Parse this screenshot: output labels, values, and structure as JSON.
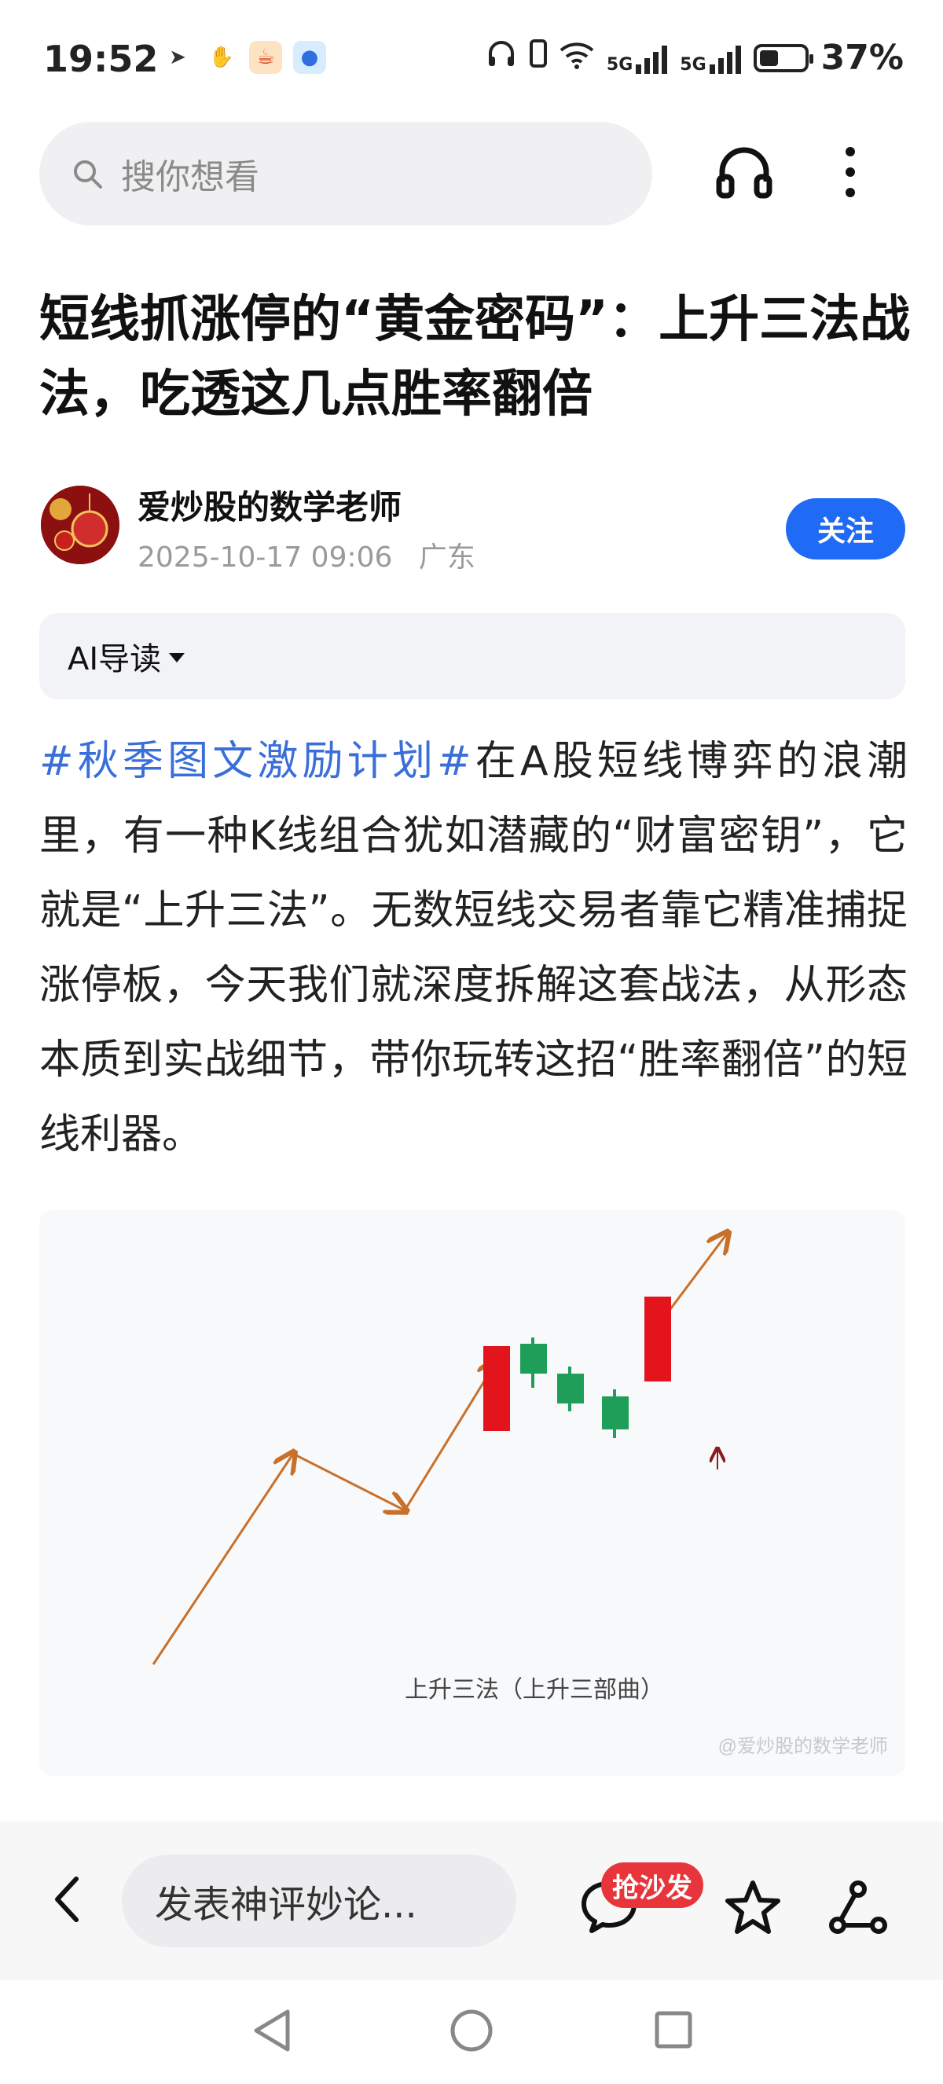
{
  "status_bar": {
    "time": "19:52",
    "network_1": "5G",
    "network_2": "5G",
    "battery_percent": "37%",
    "battery_level": 0.37
  },
  "search": {
    "placeholder": "搜你想看"
  },
  "article": {
    "title": "短线抓涨停的“黄金密码”：上升三法战法，吃透这几点胜率翻倍",
    "author": "爱炒股的数学老师",
    "datetime": "2025-10-17 09:06",
    "location": "广东",
    "follow_label": "关注",
    "ai_guide_label": "AI导读",
    "hashtag": "#秋季图文激励计划#",
    "body_text": "在A股短线博弈的浪潮里，有一种K线组合犹如潜藏的“财富密钥”，它就是“上升三法”。无数短线交易者靠它精准捕捉涨停板，今天我们就深度拆解这套战法，从形态本质到实战细节，带你玩转这招“胜率翻倍”的短线利器。",
    "figure_caption": "上升三法（上升三部曲）",
    "figure_watermark": "@爱炒股的数学老师"
  },
  "bottom_bar": {
    "comment_placeholder": "发表神评妙论...",
    "comment_badge": "抢沙发"
  },
  "colors": {
    "accent": "#1f6bf5",
    "hashtag": "#3a6ed8",
    "candle_red": "#e3141c",
    "candle_green": "#1f9e5a",
    "arrow": "#c8702a",
    "badge": "#e8353b"
  }
}
